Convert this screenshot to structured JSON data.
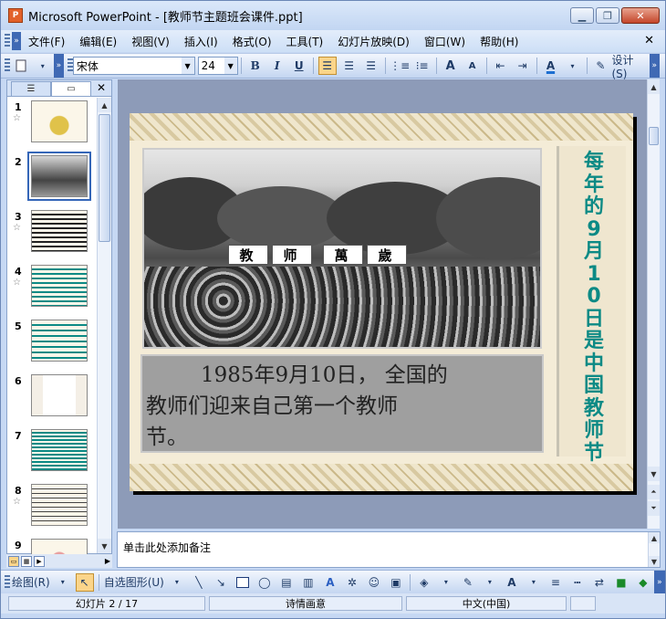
{
  "window": {
    "app_icon": "P",
    "title": "Microsoft PowerPoint - [教师节主题班会课件.ppt]",
    "min": "▁",
    "restore": "❐",
    "close": "✕"
  },
  "menu": {
    "items": [
      "文件(F)",
      "编辑(E)",
      "视图(V)",
      "插入(I)",
      "格式(O)",
      "工具(T)",
      "幻灯片放映(D)",
      "窗口(W)",
      "帮助(H)"
    ],
    "close": "✕"
  },
  "toolbar": {
    "font": "宋体",
    "size": "24",
    "bold": "B",
    "italic": "I",
    "underline": "U",
    "grow": "A",
    "shrink": "A",
    "font_color": "A",
    "design": "设计(S)"
  },
  "panel": {
    "close": "✕",
    "thumbs": [
      "1",
      "2",
      "3",
      "4",
      "5",
      "6",
      "7",
      "8",
      "9"
    ]
  },
  "slide": {
    "photo_signs": [
      "教",
      "师",
      "萬",
      "歲"
    ],
    "caption_line1": "1985年9月10日， 全国的",
    "caption_line2": "教师们迎来自己第一个教师",
    "caption_line3": "节。",
    "vertical": [
      "每",
      "年",
      "的",
      "9",
      "月",
      "1",
      "0",
      "日",
      "是",
      "中",
      "国",
      "教",
      "师",
      "节"
    ]
  },
  "notes": {
    "placeholder": "单击此处添加备注"
  },
  "draw": {
    "draw_label": "绘图(R)",
    "autoshape": "自选图形(U)"
  },
  "status": {
    "slide": "幻灯片 2 / 17",
    "design": "诗情画意",
    "lang": "中文(中国)"
  },
  "colors": {
    "accent": "#0c8a85",
    "selected": "#fbd58a"
  }
}
